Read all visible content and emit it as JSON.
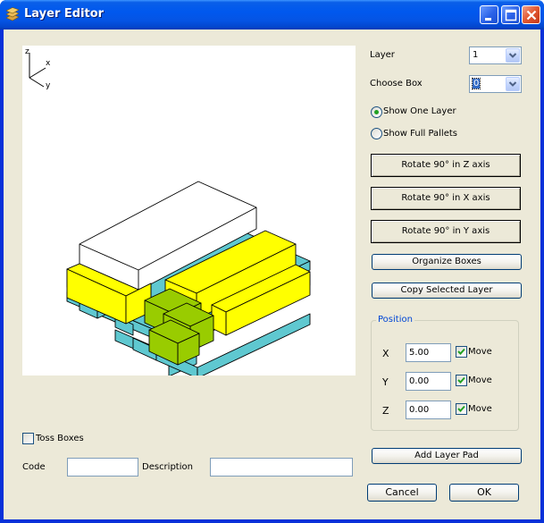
{
  "window": {
    "title": "Layer Editor",
    "controls": {
      "minimize": "minimize",
      "maximize": "maximize",
      "close": "close"
    }
  },
  "viewport": {
    "axes": {
      "z": "z",
      "x": "x",
      "y": "y"
    },
    "colors": {
      "pallet": "#5fc8d0",
      "yellow_box": "#ffff00",
      "green_box": "#99cc00",
      "white_box": "#ffffff"
    }
  },
  "layer": {
    "label": "Layer",
    "value": "1"
  },
  "choose_box": {
    "label": "Choose Box",
    "value": "0"
  },
  "view_mode": {
    "options": [
      {
        "label": "Show One Layer",
        "selected": true
      },
      {
        "label": "Show Full Pallets",
        "selected": false
      }
    ]
  },
  "buttons": {
    "rotate_z": "Rotate 90° in Z axis",
    "rotate_x": "Rotate 90° in X axis",
    "rotate_y": "Rotate 90° in Y axis",
    "organize": "Organize Boxes",
    "copy_layer": "Copy Selected Layer",
    "add_layer_pad": "Add Layer Pad",
    "cancel": "Cancel",
    "ok": "OK"
  },
  "position": {
    "title": "Position",
    "fields": [
      {
        "axis": "X",
        "value": "5.00",
        "move_label": "Move",
        "move_checked": true
      },
      {
        "axis": "Y",
        "value": "0.00",
        "move_label": "Move",
        "move_checked": true
      },
      {
        "axis": "Z",
        "value": "0.00",
        "move_label": "Move",
        "move_checked": true
      }
    ]
  },
  "toss_boxes": {
    "label": "Toss Boxes",
    "checked": false
  },
  "code": {
    "label": "Code",
    "value": ""
  },
  "description": {
    "label": "Description",
    "value": ""
  }
}
